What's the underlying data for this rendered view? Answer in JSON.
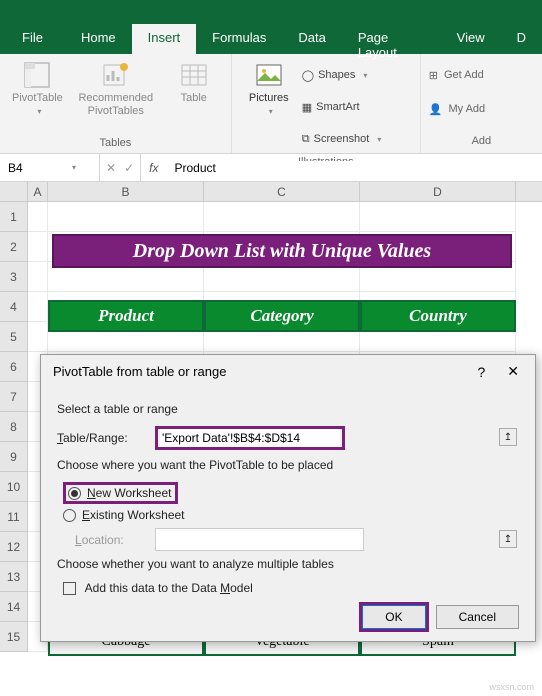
{
  "tabs": {
    "file": "File",
    "home": "Home",
    "insert": "Insert",
    "formulas": "Formulas",
    "data": "Data",
    "pagelayout": "Page Layout",
    "view": "View",
    "d": "D"
  },
  "ribbon": {
    "pivottable": "PivotTable",
    "recommended": "Recommended\nPivotTables",
    "table": "Table",
    "tables_group": "Tables",
    "pictures": "Pictures",
    "shapes": "Shapes",
    "smartart": "SmartArt",
    "screenshot": "Screenshot",
    "illustrations_group": "Illustrations",
    "getadd": "Get Add",
    "myadds": "My Add",
    "add_group": "Add"
  },
  "namebox": "B4",
  "formula": "Product",
  "columns": [
    "A",
    "B",
    "C",
    "D"
  ],
  "banner": "Drop Down List with Unique Values",
  "headers": {
    "product": "Product",
    "category": "Category",
    "country": "Country"
  },
  "lastrow": {
    "product": "Cabbage",
    "category": "Vegetable",
    "country": "Spain"
  },
  "dialog": {
    "title": "PivotTable from table or range",
    "select_label": "Select a table or range",
    "table_range_label": "Table/Range:",
    "table_range_value": "'Export Data'!$B$4:$D$14",
    "place_label": "Choose where you want the PivotTable to be placed",
    "new_ws": "New Worksheet",
    "existing_ws": "Existing Worksheet",
    "location_label": "Location:",
    "multi_label": "Choose whether you want to analyze multiple tables",
    "addmodel": "Add this data to the Data Model",
    "ok": "OK",
    "cancel": "Cancel"
  },
  "watermark": "wsxsn.com"
}
